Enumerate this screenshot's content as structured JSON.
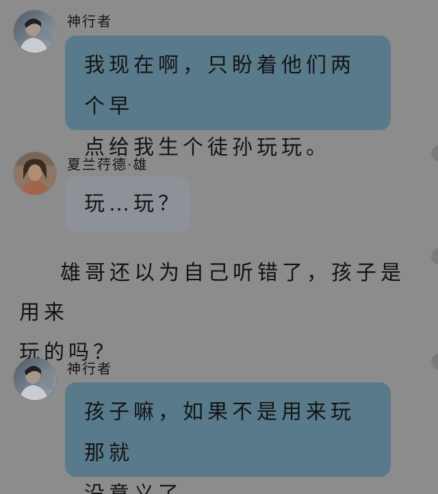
{
  "messages": [
    {
      "speaker": "神行者",
      "text_line1": "我现在啊，只盼着他们两个早",
      "text_line2": "点给我生个徒孙玩玩。"
    },
    {
      "speaker": "夏兰荇德·雄",
      "text": "玩…玩？"
    },
    {
      "speaker": "神行者",
      "text_line1": "孩子嘛，如果不是用来玩那就",
      "text_line2": "没意义了。"
    }
  ],
  "narration": {
    "line1": "雄哥还以为自己听错了，孩子是用来",
    "line2": "玩的吗？"
  },
  "colors": {
    "background": "#8c8c8c",
    "blue_bubble": "#587a8b",
    "grey_bubble": "#8d9299",
    "text": "#141414"
  },
  "icons": {
    "avatar_1": "male-avatar-icon",
    "avatar_2": "female-avatar-icon",
    "avatar_3": "male-avatar-icon"
  }
}
